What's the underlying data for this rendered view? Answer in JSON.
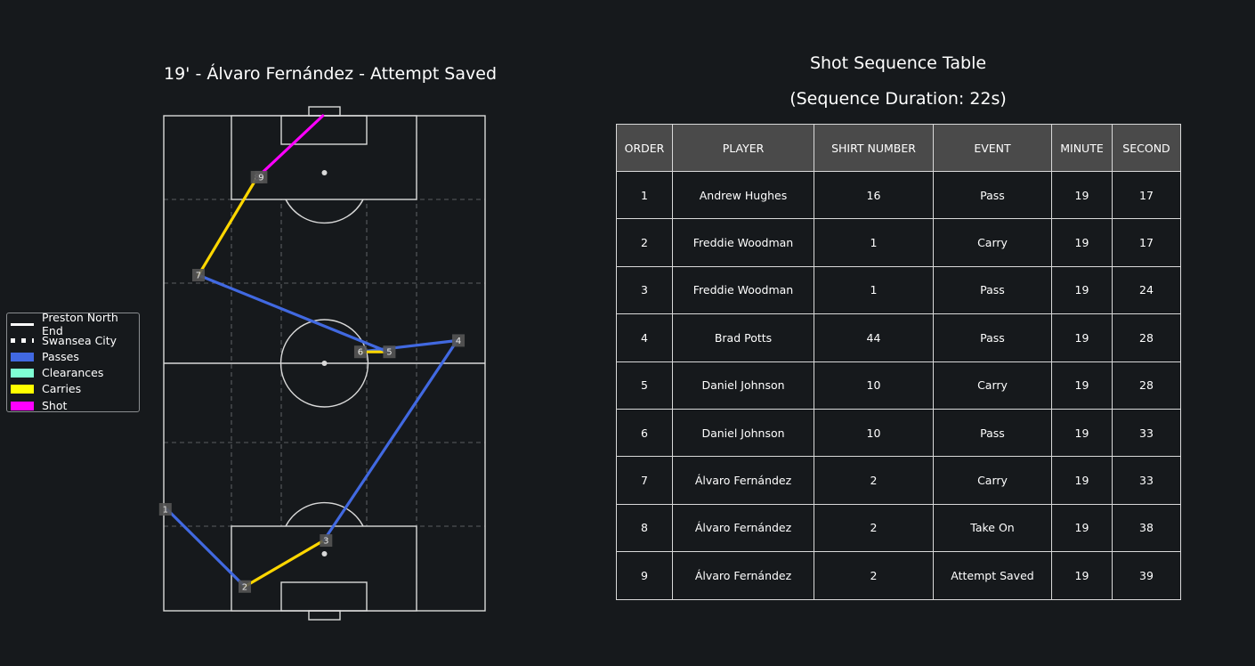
{
  "pitch": {
    "title": "19' - Álvaro Fernández - Attempt Saved"
  },
  "legend": [
    {
      "label": "Preston North End",
      "style": "line",
      "color": "#ffffff"
    },
    {
      "label": "Swansea City",
      "style": "dots",
      "color": "#ffffff"
    },
    {
      "label": "Passes",
      "style": "fill",
      "color": "#4169e1"
    },
    {
      "label": "Clearances",
      "style": "fill",
      "color": "#7fffd4"
    },
    {
      "label": "Carries",
      "style": "fill",
      "color": "#ffff00"
    },
    {
      "label": "Shot",
      "style": "fill",
      "color": "#ff00ff"
    }
  ],
  "colors": {
    "background": "#16191c",
    "pitch_lines": "#d9d9d9",
    "pass": "#4169e1",
    "carry": "#ffd700",
    "shot": "#ff00ff",
    "marker": "#555555",
    "table_header": "#4a4a4a"
  },
  "chart_data": {
    "type": "scatter",
    "pitch_dimensions": [
      100,
      100
    ],
    "events": [
      {
        "order": 1,
        "type": "pass",
        "from": [
          20.5,
          1.0
        ],
        "to": [
          4.9,
          25.2
        ]
      },
      {
        "order": 2,
        "type": "carry",
        "from": [
          4.9,
          25.2
        ],
        "to": [
          14.2,
          49.8
        ]
      },
      {
        "order": 3,
        "type": "pass",
        "from": [
          14.2,
          49.8
        ],
        "to": [
          54.6,
          91.3
        ]
      },
      {
        "order": 4,
        "type": "pass",
        "from": [
          54.6,
          91.3
        ],
        "to": [
          52.3,
          61.0
        ]
      },
      {
        "order": 5,
        "type": "carry",
        "from": [
          52.3,
          61.0
        ],
        "to": [
          52.3,
          69.8
        ]
      },
      {
        "order": 6,
        "type": "pass",
        "from": [
          52.3,
          69.8
        ],
        "to": [
          67.8,
          10.8
        ]
      },
      {
        "order": 7,
        "type": "carry",
        "from": [
          67.8,
          10.8
        ],
        "to": [
          87.5,
          29.0
        ]
      },
      {
        "order": 8,
        "type": "carry",
        "from": [
          87.5,
          29.0
        ],
        "to": [
          87.5,
          29.0
        ]
      },
      {
        "order": 9,
        "type": "shot",
        "from": [
          87.5,
          29.0
        ],
        "to": [
          100.0,
          49.5
        ]
      }
    ],
    "markers": [
      {
        "label": "1",
        "pos": [
          20.5,
          0.5
        ]
      },
      {
        "label": "2",
        "pos": [
          4.9,
          25.2
        ]
      },
      {
        "label": "3",
        "pos": [
          14.2,
          50.5
        ]
      },
      {
        "label": "4",
        "pos": [
          54.6,
          91.7
        ]
      },
      {
        "label": "5",
        "pos": [
          52.3,
          70.2
        ]
      },
      {
        "label": "6",
        "pos": [
          52.3,
          61.2
        ]
      },
      {
        "label": "7",
        "pos": [
          67.8,
          10.8
        ]
      },
      {
        "label": "8",
        "pos": [
          87.6,
          29.0
        ]
      },
      {
        "label": "9",
        "pos": [
          87.6,
          30.3
        ]
      }
    ]
  },
  "table": {
    "title": "Shot Sequence Table",
    "subtitle": "(Sequence Duration: 22s)",
    "columns": [
      "ORDER",
      "PLAYER",
      "SHIRT NUMBER",
      "EVENT",
      "MINUTE",
      "SECOND"
    ],
    "rows": [
      [
        "1",
        "Andrew Hughes",
        "16",
        "Pass",
        "19",
        "17"
      ],
      [
        "2",
        "Freddie Woodman",
        "1",
        "Carry",
        "19",
        "17"
      ],
      [
        "3",
        "Freddie Woodman",
        "1",
        "Pass",
        "19",
        "24"
      ],
      [
        "4",
        "Brad Potts",
        "44",
        "Pass",
        "19",
        "28"
      ],
      [
        "5",
        "Daniel Johnson",
        "10",
        "Carry",
        "19",
        "28"
      ],
      [
        "6",
        "Daniel Johnson",
        "10",
        "Pass",
        "19",
        "33"
      ],
      [
        "7",
        "Álvaro Fernández",
        "2",
        "Carry",
        "19",
        "33"
      ],
      [
        "8",
        "Álvaro Fernández",
        "2",
        "Take On",
        "19",
        "38"
      ],
      [
        "9",
        "Álvaro Fernández",
        "2",
        "Attempt Saved",
        "19",
        "39"
      ]
    ]
  }
}
